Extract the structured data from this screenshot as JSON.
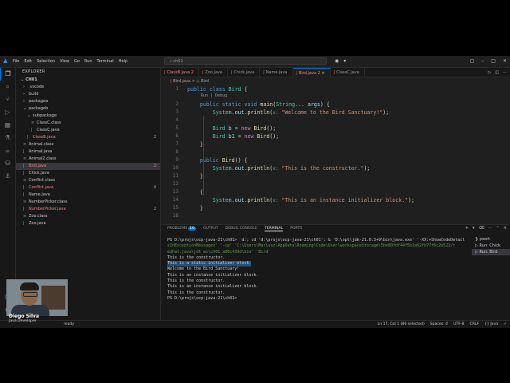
{
  "title_bar": {
    "menu": [
      "File",
      "Edit",
      "Selection",
      "View",
      "Go",
      "Run",
      "Terminal",
      "Help"
    ],
    "search": "ch01"
  },
  "activity_bar": [
    "files-icon",
    "search-icon",
    "source-control-icon",
    "run-debug-icon",
    "extensions-icon",
    "testing-icon",
    "java-icon",
    "database-icon",
    "docker-icon",
    "account-icon",
    "settings-icon"
  ],
  "sidebar": {
    "header": "EXPLORER",
    "section": "CH01",
    "items": [
      {
        "label": ".vscode",
        "kind": "folder",
        "indent": 1
      },
      {
        "label": "build",
        "kind": "folder",
        "indent": 1
      },
      {
        "label": "packagea",
        "kind": "folder",
        "indent": 1
      },
      {
        "label": "packageb",
        "kind": "folder-open",
        "indent": 1
      },
      {
        "label": "subpackage",
        "kind": "folder-open",
        "indent": 2
      },
      {
        "label": "ClassC.class",
        "kind": "class",
        "indent": 3
      },
      {
        "label": "ClassC.java",
        "kind": "java",
        "indent": 3
      },
      {
        "label": "ClassB.java",
        "kind": "java",
        "indent": 2,
        "badge": "2"
      },
      {
        "label": "Animal.class",
        "kind": "class",
        "indent": 1
      },
      {
        "label": "Animal.java",
        "kind": "java",
        "indent": 1
      },
      {
        "label": "Animal2.class",
        "kind": "class",
        "indent": 1
      },
      {
        "label": "Bird.java",
        "kind": "java",
        "indent": 1,
        "badge": "2",
        "selected": true
      },
      {
        "label": "Chick.java",
        "kind": "java",
        "indent": 1
      },
      {
        "label": "Conflict.class",
        "kind": "class",
        "indent": 1
      },
      {
        "label": "Conflict.java",
        "kind": "java",
        "indent": 1,
        "badge": "4"
      },
      {
        "label": "Name.java",
        "kind": "java",
        "indent": 1
      },
      {
        "label": "NumberPicker.class",
        "kind": "class",
        "indent": 1
      },
      {
        "label": "NumberPicker.java",
        "kind": "java",
        "indent": 1,
        "badge": "2"
      },
      {
        "label": "Zoo.class",
        "kind": "class",
        "indent": 1
      },
      {
        "label": "Zoo.java",
        "kind": "java",
        "indent": 1
      }
    ]
  },
  "tabs": [
    {
      "label": "ClassB.java",
      "suffix": "2"
    },
    {
      "label": "Zoo.java",
      "suffix": ""
    },
    {
      "label": "Chick.java",
      "suffix": ""
    },
    {
      "label": "Name.java",
      "suffix": ""
    },
    {
      "label": "Bird.java",
      "suffix": "2",
      "active": true
    },
    {
      "label": "ClassC.java",
      "suffix": ""
    }
  ],
  "breadcrumb": {
    "file": "Bird.java",
    "symbol": "Bird"
  },
  "codelens": "Run | Debug",
  "code_lines": [
    {
      "n": "1",
      "html": "<span class='kw'>public</span> <span class='kw'>class</span> <span class='cls'>Bird</span> {"
    },
    {
      "n": "2",
      "html": "    <span class='kw'>public</span> <span class='kw'>static</span> <span class='kw'>void</span> <span class='fn'>main</span>(<span class='cls'>String</span>... <span class='var'>args</span>) {"
    },
    {
      "n": "3",
      "html": "        <span class='cls'>System</span>.<span class='var'>out</span>.<span class='fn'>println</span>(<span class='hint'>x:</span> <span class='str'>\"Welcome to the Bird Sanctuary!\"</span>);"
    },
    {
      "n": "4",
      "html": ""
    },
    {
      "n": "5",
      "html": "        <span class='cls'>Bird</span> <span class='var'>b</span> = <span class='kc'>new</span> <span class='fn'>Bird</span>();"
    },
    {
      "n": "6",
      "html": "        <span class='cls'>Bird</span> <span class='var'>b1</span> = <span class='kc'>new</span> <span class='fn'>Bird</span>();"
    },
    {
      "n": "7",
      "html": "    }"
    },
    {
      "n": "8",
      "html": ""
    },
    {
      "n": "9",
      "html": "    <span class='kw'>public</span> <span class='fn'>Bird</span>() {"
    },
    {
      "n": "10",
      "html": "        <span class='cls'>System</span>.<span class='var'>out</span>.<span class='fn'>println</span>(<span class='hint'>x:</span> <span class='str'>\"This is the constructor.\"</span>);"
    },
    {
      "n": "11",
      "html": "    }"
    },
    {
      "n": "12",
      "html": ""
    },
    {
      "n": "13",
      "html": "    {"
    },
    {
      "n": "14",
      "html": "        <span class='cls'>System</span>.<span class='var'>out</span>.<span class='fn'>println</span>(<span class='hint'>x:</span> <span class='str'>\"This is an instance initializer block.\"</span>);"
    },
    {
      "n": "15",
      "html": "    }"
    },
    {
      "n": "16",
      "html": ""
    }
  ],
  "panel": {
    "tabs": [
      {
        "label": "PROBLEMS",
        "badge": "10"
      },
      {
        "label": "OUTPUT"
      },
      {
        "label": "DEBUG CONSOLE"
      },
      {
        "label": "TERMINAL",
        "active": true
      },
      {
        "label": "PORTS"
      }
    ],
    "terminal_lines": [
      {
        "text": "PS D:\\projs\\ocp-java-21\\ch01>  d:; cd 'd:\\projs\\ocp-java-21\\ch01'; & 'D:\\opt\\jdk-21.0.3+9\\bin\\java.exe' '-XX:+ShowCodeDetail",
        "cls": ""
      },
      {
        "text": "sInExceptionMessages' '-cp' 'C:\\Users\\Mariusz\\AppData\\Roaming\\Code\\User\\workspaceStorage\\5be80fdf44f5b1a62fb77f6c2b521/r",
        "cls": "dim"
      },
      {
        "text": "edhat.java\\jdt_ws\\ch01_a86c439d\\bin' 'Bird'",
        "cls": "dim"
      },
      {
        "text": "This is the constructor.",
        "cls": ""
      },
      {
        "text": "This is a static initializer block.",
        "cls": "hl"
      },
      {
        "text": "Welcome to the Bird Sanctuary!",
        "cls": ""
      },
      {
        "text": "This is an instance initializer block.",
        "cls": ""
      },
      {
        "text": "This is the constructor.",
        "cls": ""
      },
      {
        "text": "This is an instance initializer block.",
        "cls": ""
      },
      {
        "text": "This is the constructor.",
        "cls": ""
      },
      {
        "text": "PS D:\\projs\\ocp-java-21\\ch01> ",
        "cls": ""
      }
    ],
    "terminal_list": [
      {
        "label": "pwsh",
        "selected": false
      },
      {
        "label": "Run: Chick",
        "selected": false
      },
      {
        "label": "Run: Bird",
        "selected": true
      }
    ]
  },
  "status_bar": {
    "left": "ready",
    "items": [
      "Ln 17, Col 1 (86 selected)",
      "Spaces: 4",
      "UTF-8",
      "CRLF",
      "{} Java",
      "✓"
    ]
  },
  "webcam": {
    "name": "Diego Silva",
    "role": "Java Developer"
  }
}
